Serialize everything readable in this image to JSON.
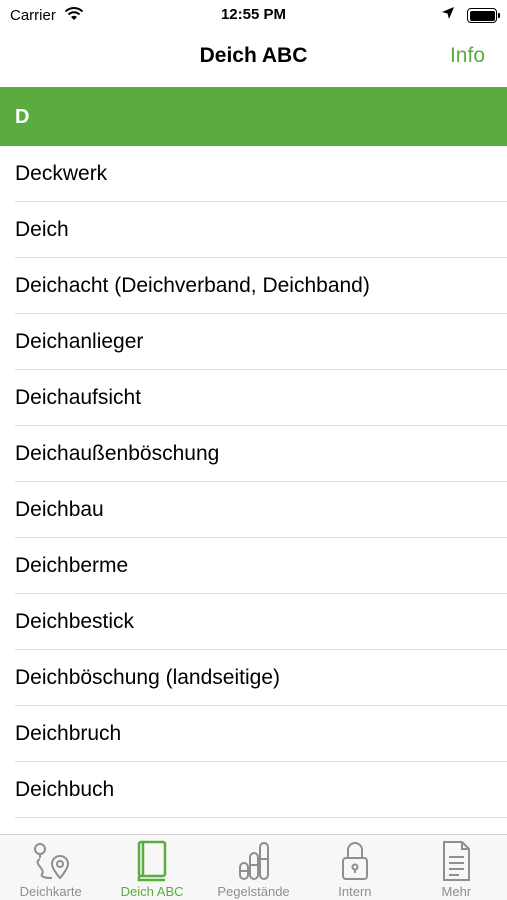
{
  "status_bar": {
    "carrier": "Carrier",
    "time": "12:55 PM",
    "battery_level": 1.0
  },
  "nav": {
    "title": "Deich ABC",
    "info_label": "Info"
  },
  "section": {
    "letter": "D"
  },
  "list": {
    "items": [
      "Deckwerk",
      "Deich",
      "Deichacht (Deichverband, Deichband)",
      "Deichanlieger",
      "Deichaufsicht",
      "Deichaußenböschung",
      "Deichbau",
      "Deichberme",
      "Deichbestick",
      "Deichböschung (landseitige)",
      "Deichbruch",
      "Deichbuch"
    ]
  },
  "tab_bar": {
    "tabs": [
      {
        "label": "Deichkarte",
        "icon": "map-route-icon",
        "active": false
      },
      {
        "label": "Deich ABC",
        "icon": "book-icon",
        "active": true
      },
      {
        "label": "Pegelstände",
        "icon": "level-bars-icon",
        "active": false
      },
      {
        "label": "Intern",
        "icon": "lock-icon",
        "active": false
      },
      {
        "label": "Mehr",
        "icon": "document-icon",
        "active": false
      }
    ]
  },
  "colors": {
    "accent": "#5aac3f",
    "inactive": "#8e8e93"
  }
}
